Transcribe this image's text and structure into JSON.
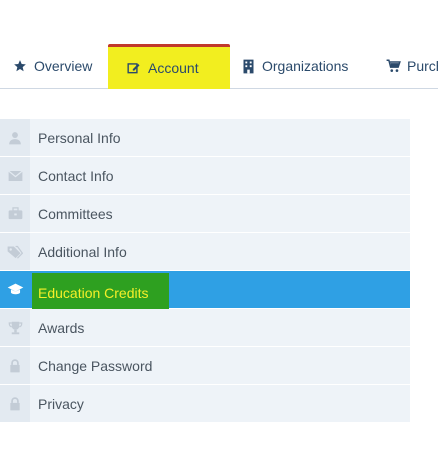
{
  "colors": {
    "tab_text": "#2b4a6b",
    "highlight_yellow": "#f2ee1f",
    "active_blue": "#2fa0e4",
    "active_green": "#2ea020",
    "active_text": "#f5ef29",
    "menu_bg": "#eef3f8",
    "icon_gray": "#c3ccd6"
  },
  "tabs": [
    {
      "label": "Overview",
      "icon": "star-icon"
    },
    {
      "label": "Account",
      "icon": "edit-icon",
      "active": true
    },
    {
      "label": "Organizations",
      "icon": "building-icon"
    },
    {
      "label": "Purch",
      "icon": "cart-icon"
    }
  ],
  "menu": [
    {
      "label": "Personal Info",
      "icon": "user-icon"
    },
    {
      "label": "Contact Info",
      "icon": "envelope-icon"
    },
    {
      "label": "Committees",
      "icon": "briefcase-icon"
    },
    {
      "label": "Additional Info",
      "icon": "tags-icon"
    },
    {
      "label": "Education Credits",
      "icon": "graduation-cap-icon",
      "active": true
    },
    {
      "label": "Awards",
      "icon": "trophy-icon"
    },
    {
      "label": "Change Password",
      "icon": "lock-icon"
    },
    {
      "label": "Privacy",
      "icon": "lock-icon"
    }
  ]
}
